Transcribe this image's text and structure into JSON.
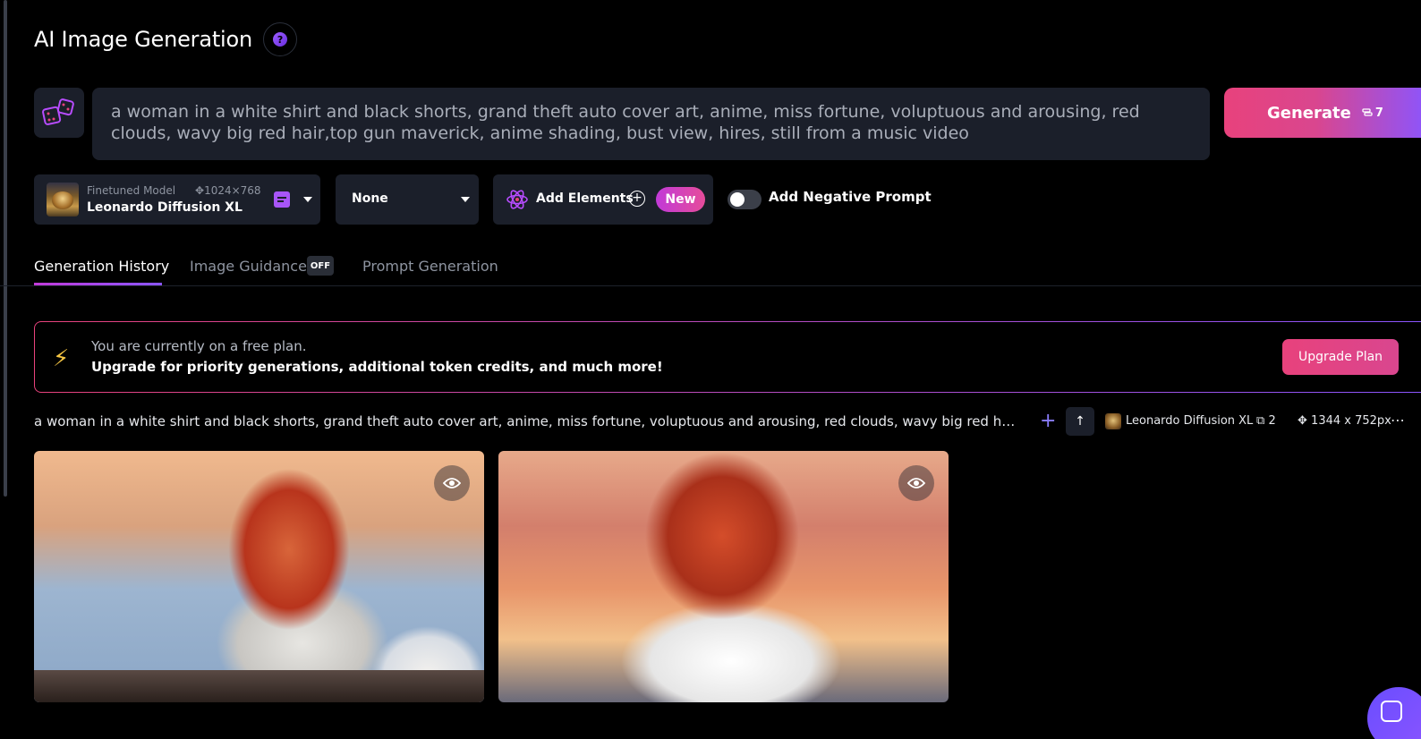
{
  "header": {
    "title": "AI Image Generation",
    "help_icon": "question-icon",
    "help_glyph": "?"
  },
  "prompt": {
    "text": "a woman in a white shirt and black shorts, grand theft auto cover art, anime, miss fortune, voluptuous and arousing, red clouds, wavy big red hair,top gun maverick, anime shading, bust view, hires, still from a music video",
    "random_icon": "dice-icon"
  },
  "generate": {
    "label": "Generate",
    "token_cost": "7"
  },
  "model": {
    "caption": "Finetuned Model",
    "resolution": "1024×768",
    "name": "Leonardo Diffusion XL"
  },
  "style": {
    "value": "None"
  },
  "elements": {
    "label": "Add Elements",
    "badge": "New"
  },
  "negative_prompt": {
    "label": "Add Negative Prompt",
    "enabled": false
  },
  "tabs": [
    {
      "label": "Generation History",
      "active": true
    },
    {
      "label": "Image Guidance",
      "badge": "OFF"
    },
    {
      "label": "Prompt Generation"
    }
  ],
  "banner": {
    "line1": "You are currently on a free plan.",
    "line2": "Upgrade for priority generations, additional token credits, and much more!",
    "button": "Upgrade Plan"
  },
  "generation": {
    "prompt": "a woman in a white shirt and black shorts, grand theft auto cover art, anime, miss fortune, voluptuous and arousing, red clouds, wavy big red hair,top gun...",
    "model": "Leonardo Diffusion XL",
    "count": "2",
    "dimensions": "1344 x 752px",
    "more": "⋯",
    "up": "↑",
    "plus": "+"
  },
  "colors": {
    "accent_pink": "#e8427c",
    "accent_purple": "#8a55ff",
    "panel": "#1b1f2a"
  }
}
